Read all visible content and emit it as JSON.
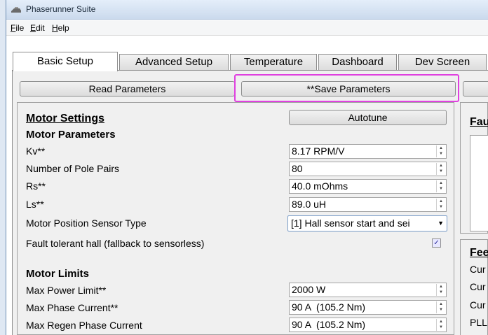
{
  "window": {
    "title": "Phaserunner Suite"
  },
  "menu": {
    "file": "File",
    "edit": "Edit",
    "help": "Help"
  },
  "tabs": [
    {
      "label": "Basic Setup"
    },
    {
      "label": "Advanced Setup"
    },
    {
      "label": "Temperature"
    },
    {
      "label": "Dashboard"
    },
    {
      "label": "Dev Screen"
    }
  ],
  "buttons": {
    "read": "Read Parameters",
    "save": "**Save Parameters",
    "autotune": "Autotune"
  },
  "motor": {
    "heading": "Motor Settings",
    "params_heading": "Motor Parameters",
    "kv": {
      "label": "Kv**",
      "value": "8.17 RPM/V"
    },
    "pole_pairs": {
      "label": "Number of Pole Pairs",
      "value": "80"
    },
    "rs": {
      "label": "Rs**",
      "value": "40.0 mOhms"
    },
    "ls": {
      "label": "Ls**",
      "value": "89.0 uH"
    },
    "sensor_type": {
      "label": "Motor Position Sensor Type",
      "value": "[1] Hall sensor start and sei"
    },
    "fault_tolerant": {
      "label": "Fault tolerant hall (fallback to sensorless)",
      "checked": true
    },
    "limits_heading": "Motor Limits",
    "max_power": {
      "label": "Max Power Limit**",
      "value": "2000 W"
    },
    "max_phase": {
      "label": "Max Phase Current**",
      "value": "90 A  (105.2 Nm)"
    },
    "max_regen": {
      "label": "Max Regen Phase Current",
      "value": "90 A  (105.2 Nm)"
    }
  },
  "right": {
    "heading1": "Fau",
    "heading2": "Fee",
    "rows": [
      "Cur",
      "Cur",
      "Cur",
      "PLL"
    ]
  }
}
